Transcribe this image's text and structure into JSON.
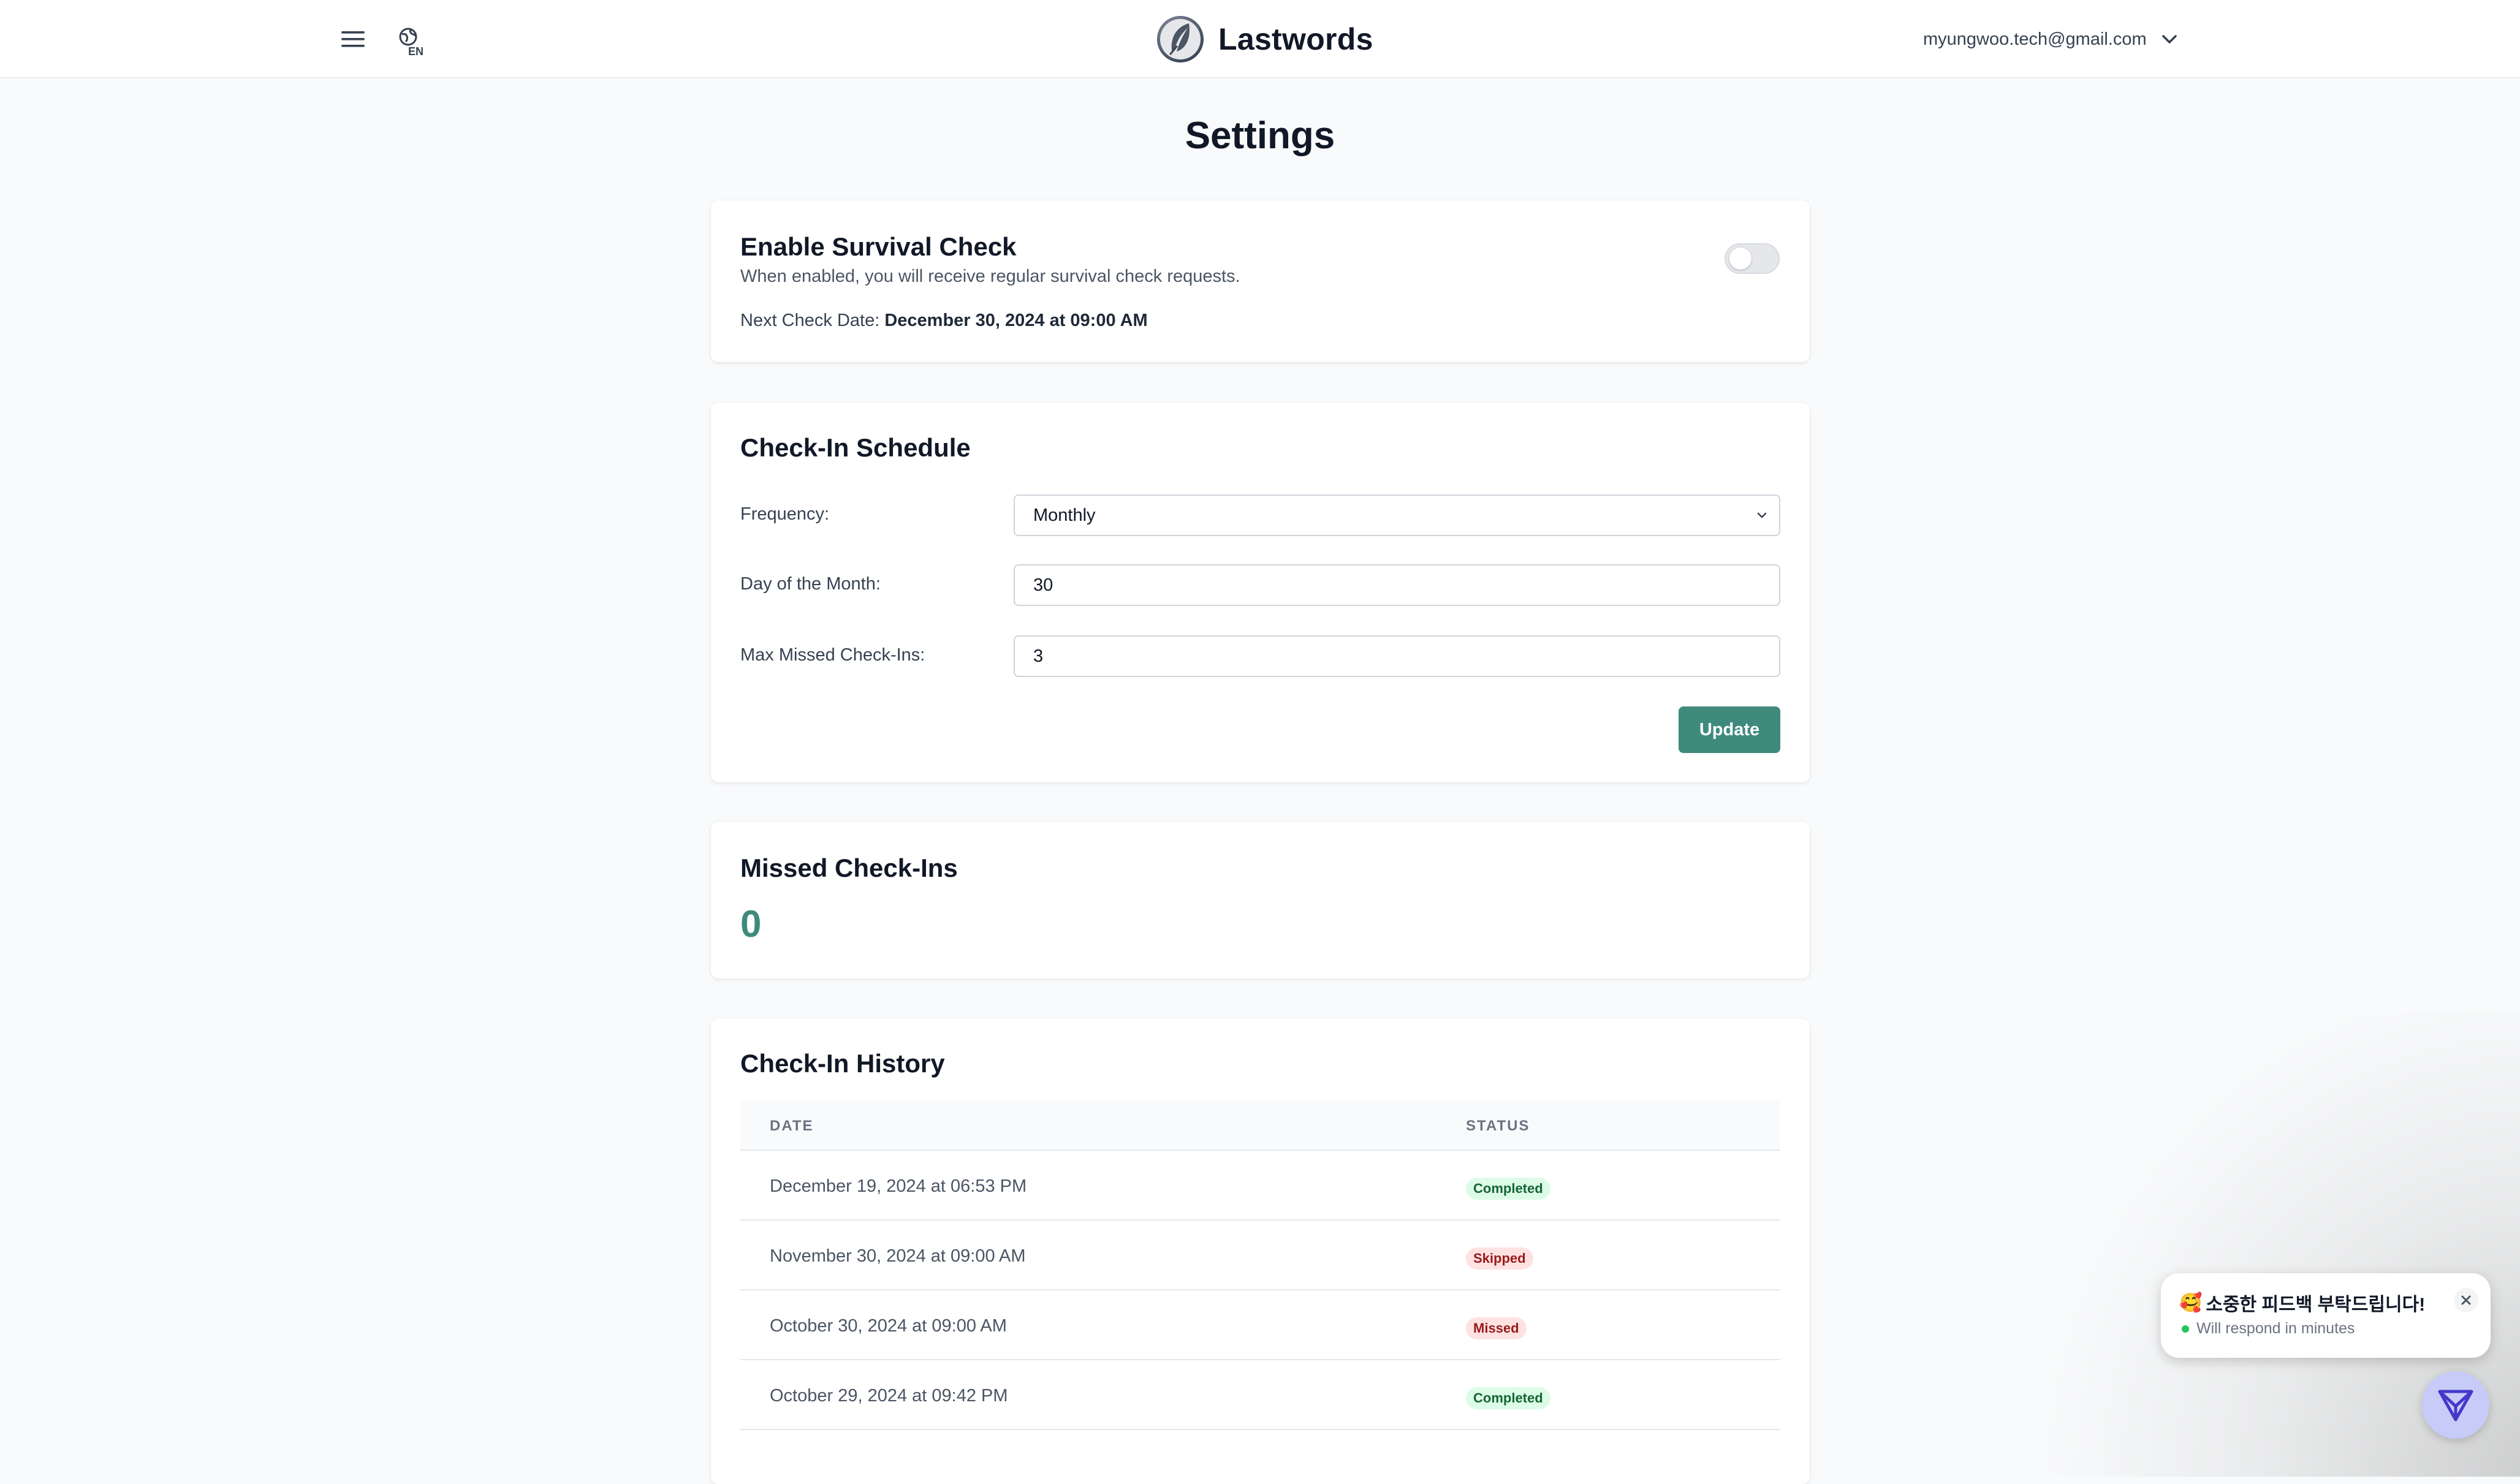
{
  "header": {
    "lang_code": "EN",
    "brand_name": "Lastwords",
    "user_email": "myungwoo.tech@gmail.com"
  },
  "page": {
    "title": "Settings"
  },
  "survival_check": {
    "title": "Enable Survival Check",
    "description": "When enabled, you will receive regular survival check requests.",
    "next_check_label": "Next Check Date:",
    "next_check_value": "December 30, 2024 at 09:00 AM",
    "enabled": false
  },
  "schedule": {
    "title": "Check-In Schedule",
    "frequency_label": "Frequency:",
    "frequency_value": "Monthly",
    "day_label": "Day of the Month:",
    "day_value": "30",
    "max_missed_label": "Max Missed Check-Ins:",
    "max_missed_value": "3",
    "update_label": "Update"
  },
  "missed": {
    "title": "Missed Check-Ins",
    "count": "0"
  },
  "history": {
    "title": "Check-In History",
    "col_date": "DATE",
    "col_status": "STATUS",
    "rows": [
      {
        "date": "December 19, 2024 at 06:53 PM",
        "status": "Completed"
      },
      {
        "date": "November 30, 2024 at 09:00 AM",
        "status": "Skipped"
      },
      {
        "date": "October 30, 2024 at 09:00 AM",
        "status": "Missed"
      },
      {
        "date": "October 29, 2024 at 09:42 PM",
        "status": "Completed"
      }
    ]
  },
  "feedback_widget": {
    "emoji": "🥰",
    "title": "소중한 피드백 부탁드립니다!",
    "subtitle": "Will respond in minutes"
  },
  "colors": {
    "accent": "#3f8a7d",
    "completed_bg": "#dcfce7",
    "completed_fg": "#166534",
    "warn_bg": "#fee2e2",
    "warn_fg": "#991b1b",
    "fab_bg": "#c7cbf8"
  },
  "icons": {
    "menu": "hamburger-icon",
    "language": "globe-icon",
    "user_menu": "chevron-down-icon",
    "select": "chevron-down-icon",
    "close": "close-icon",
    "fab": "paper-plane-icon"
  }
}
